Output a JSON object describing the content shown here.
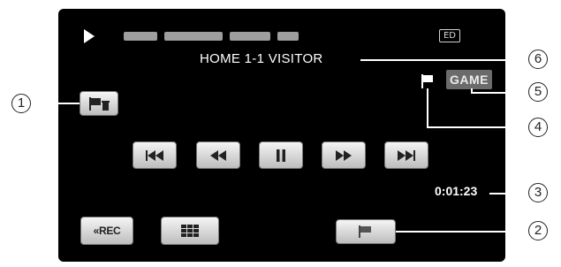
{
  "screen": {
    "title": "HOME 1-1 VISITOR",
    "quality_badge": "ED",
    "game_tag": "GAME",
    "elapsed_time": "0:01:23"
  },
  "buttons": {
    "rec_label": "REC",
    "rec_arrow": "«",
    "game_mode_icon": "flag-trash-icon",
    "index_icon": "grid-icon",
    "flag_icon": "flag-icon",
    "skip_back_icon": "skip-previous-icon",
    "rewind_icon": "rewind-icon",
    "pause_icon": "pause-icon",
    "fast_forward_icon": "fast-forward-icon",
    "skip_forward_icon": "skip-next-icon"
  },
  "callouts": [
    "1",
    "2",
    "3",
    "4",
    "5",
    "6"
  ],
  "colors": {
    "screen_bg": "#000000",
    "button_light": "#f5f5f5",
    "button_dark": "#bdbdbd",
    "game_tag_bg": "#6b6b6b",
    "mask": "#9e9e9e"
  }
}
